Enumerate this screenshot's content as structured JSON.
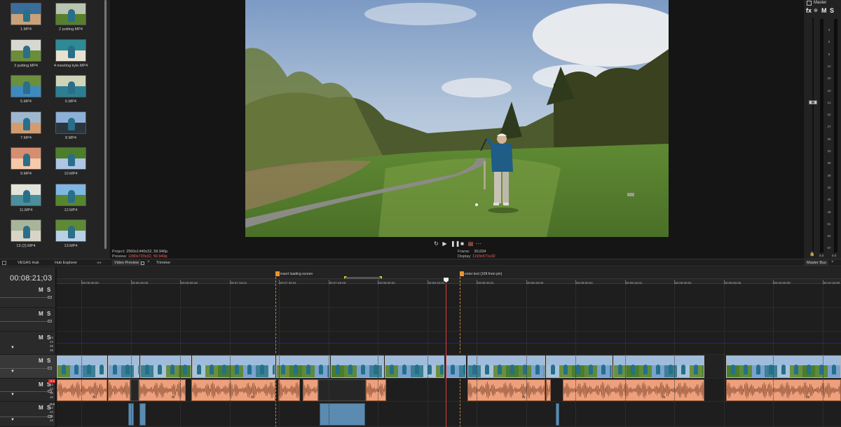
{
  "media_bin": {
    "items": [
      {
        "label": "1.MP4"
      },
      {
        "label": "2 putting.MP4"
      },
      {
        "label": "3 putting.MP4"
      },
      {
        "label": "4 meeting kyle.MP4"
      },
      {
        "label": "5.MP4"
      },
      {
        "label": "6.MP4"
      },
      {
        "label": "7.MP4"
      },
      {
        "label": "8.MP4"
      },
      {
        "label": "9.MP4"
      },
      {
        "label": "10.MP4"
      },
      {
        "label": "11.MP4"
      },
      {
        "label": "12.MP4"
      },
      {
        "label": "13 (2).MP4"
      },
      {
        "label": "13.MP4"
      }
    ]
  },
  "preview": {
    "project_label": "Project:",
    "project_value": "2560x1440x32, 59.940p",
    "preview_label": "Preview:",
    "preview_value": "1280x720x32, 59.940p",
    "frame_label": "Frame:",
    "frame_value": "30,034",
    "display_label": "Display:",
    "display_value": "1193x671x32"
  },
  "transport": {
    "loop_icon": "loop-icon",
    "play_icon": "play-icon",
    "pause_icon": "pause-icon",
    "stop_icon": "stop-icon",
    "mixer_icon": "mixer-icon",
    "more": "···"
  },
  "master": {
    "title": "Master",
    "fx": "fx",
    "m": "M",
    "s": "S",
    "scale": [
      "3",
      "6",
      "9",
      "12",
      "15",
      "18",
      "21",
      "24",
      "27",
      "30",
      "33",
      "36",
      "39",
      "42",
      "45",
      "48",
      "51",
      "54",
      "57"
    ],
    "readout_left": "0.0",
    "readout_right": "0.0",
    "fader_left": "0.0",
    "fader_right": "0.0",
    "bus_tab": "Master Bus"
  },
  "tabs": [
    "VEGAS Hub",
    "Hub Explorer",
    "Video Preview",
    "Trimmer"
  ],
  "timeline": {
    "timecode": "00:08:21;03",
    "ruler": [
      "00:06:30:00",
      "00:06:45:00",
      "00:06:59:29",
      "00:07:15:01",
      "00:07:30:01",
      "00:07:45:00",
      "00:08:00:02",
      "00:08:15:01",
      "00:08:30:01",
      "00:08:45:00",
      "00:09:00:02",
      "00:09:15:01",
      "00:09:30:01",
      "00:09:45:00",
      "00:10:00:00",
      "00:10:15:00"
    ],
    "markers": [
      {
        "label": "insert loading screen"
      },
      {
        "label": "enter text (10ft from pin)"
      }
    ],
    "tracks": [
      {
        "m": "M",
        "s": "S"
      },
      {
        "m": "M",
        "s": "S"
      },
      {
        "m": "M",
        "s": "S",
        "scale": [
          "12",
          "24",
          "36",
          "48"
        ]
      },
      {
        "m": "M",
        "s": "S"
      },
      {
        "m": "M",
        "s": "S",
        "scale": [
          "12",
          "24",
          "36",
          "48"
        ],
        "level": "-3.3"
      },
      {
        "m": "M",
        "s": "S",
        "scale": [
          "12",
          "24",
          "36",
          "48"
        ],
        "level": "-0.6"
      }
    ],
    "fx_label": "fx"
  },
  "colors": {
    "audio_clip": "#eea07c",
    "cursor": "#e03b3b",
    "marker": "#f09330",
    "blue_clip": "#5b8bb0"
  }
}
